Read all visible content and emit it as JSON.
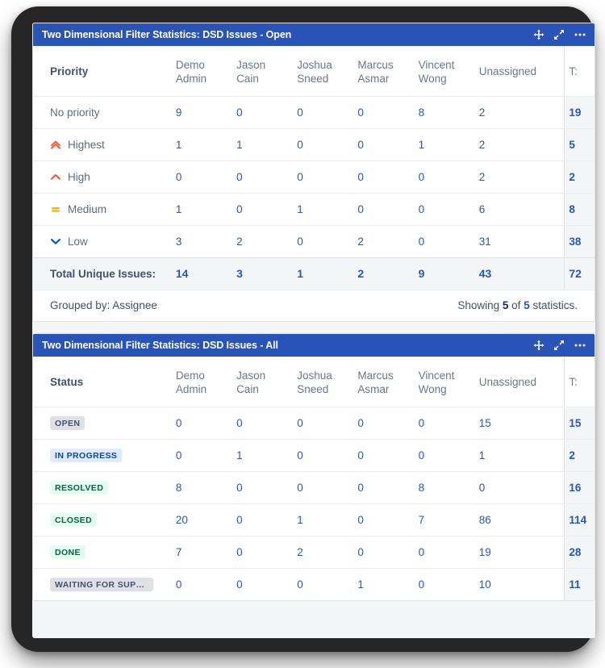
{
  "panels": [
    {
      "title": "Two Dimensional Filter Statistics: DSD Issues - Open",
      "actions": {
        "move": "move-icon",
        "expand": "expand-icon",
        "more": "more-options-icon"
      },
      "row_header": "Priority",
      "columns": [
        {
          "first": "Demo",
          "last": "Admin"
        },
        {
          "first": "Jason",
          "last": "Cain"
        },
        {
          "first": "Joshua",
          "last": "Sneed"
        },
        {
          "first": "Marcus",
          "last": "Asmar"
        },
        {
          "first": "Vincent",
          "last": "Wong"
        }
      ],
      "unassigned_label": "Unassigned",
      "total_label": "T:",
      "rows": [
        {
          "label": "No priority",
          "icon": "none",
          "values": [
            "9",
            "0",
            "0",
            "0",
            "8",
            "2"
          ],
          "total": "19"
        },
        {
          "label": "Highest",
          "icon": "highest",
          "values": [
            "1",
            "1",
            "0",
            "0",
            "1",
            "2"
          ],
          "total": "5"
        },
        {
          "label": "High",
          "icon": "high",
          "values": [
            "0",
            "0",
            "0",
            "0",
            "0",
            "2"
          ],
          "total": "2"
        },
        {
          "label": "Medium",
          "icon": "medium",
          "values": [
            "1",
            "0",
            "1",
            "0",
            "0",
            "6"
          ],
          "total": "8"
        },
        {
          "label": "Low",
          "icon": "low",
          "values": [
            "3",
            "2",
            "0",
            "2",
            "0",
            "31"
          ],
          "total": "38"
        }
      ],
      "total_row": {
        "label": "Total Unique Issues:",
        "values": [
          "14",
          "3",
          "1",
          "2",
          "9",
          "43"
        ],
        "total": "72"
      },
      "footer": {
        "grouped_by": "Grouped by: Assignee",
        "showing_prefix": "Showing",
        "showing_count": "5",
        "showing_of": "of",
        "showing_total": "5",
        "showing_suffix": "statistics."
      }
    },
    {
      "title": "Two Dimensional Filter Statistics: DSD Issues - All",
      "actions": {
        "move": "move-icon",
        "expand": "expand-icon",
        "more": "more-options-icon"
      },
      "row_header": "Status",
      "columns": [
        {
          "first": "Demo",
          "last": "Admin"
        },
        {
          "first": "Jason",
          "last": "Cain"
        },
        {
          "first": "Joshua",
          "last": "Sneed"
        },
        {
          "first": "Marcus",
          "last": "Asmar"
        },
        {
          "first": "Vincent",
          "last": "Wong"
        }
      ],
      "unassigned_label": "Unassigned",
      "total_label": "T:",
      "rows": [
        {
          "label": "OPEN",
          "lozenge": "gray",
          "values": [
            "0",
            "0",
            "0",
            "0",
            "0",
            "15"
          ],
          "total": "15"
        },
        {
          "label": "IN PROGRESS",
          "lozenge": "blue",
          "values": [
            "0",
            "1",
            "0",
            "0",
            "0",
            "1"
          ],
          "total": "2"
        },
        {
          "label": "RESOLVED",
          "lozenge": "green",
          "values": [
            "8",
            "0",
            "0",
            "0",
            "8",
            "0"
          ],
          "total": "16"
        },
        {
          "label": "CLOSED",
          "lozenge": "green",
          "values": [
            "20",
            "0",
            "1",
            "0",
            "7",
            "86"
          ],
          "total": "114"
        },
        {
          "label": "DONE",
          "lozenge": "green",
          "values": [
            "7",
            "0",
            "2",
            "0",
            "0",
            "19"
          ],
          "total": "28"
        },
        {
          "label": "WAITING FOR SUPPO…",
          "lozenge": "gray",
          "values": [
            "0",
            "0",
            "0",
            "1",
            "0",
            "10"
          ],
          "total": "11"
        }
      ]
    }
  ],
  "colors": {
    "header_blue": "#2a53b8",
    "value_blue": "#2457c5",
    "priority_highest": "#ff5630",
    "priority_high": "#ff5630",
    "priority_medium": "#ffab00",
    "priority_low": "#0052cc",
    "total_bg": "#f4f5f7",
    "page_bg": "#f4f5f7",
    "bezel": "#262626"
  }
}
